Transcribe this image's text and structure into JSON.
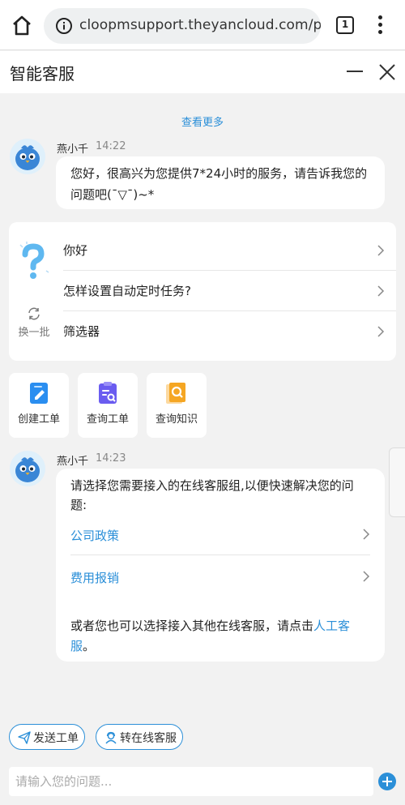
{
  "browser": {
    "url": "cloopmsupport.theyancloud.com/por",
    "tab_count": "1"
  },
  "chat": {
    "title": "智能客服",
    "load_more": "查看更多"
  },
  "messages": [
    {
      "sender": "燕小千",
      "time": "14:22",
      "text_line1": "您好，很高兴为您提供7*24小时的服务，请告诉我您的",
      "text_line2": "问题吧(¯▽¯)~*"
    },
    {
      "sender": "燕小千",
      "time": "14:23",
      "intro_line1": "请选择您需要接入的在线客服组,以便快速解决您的问",
      "intro_line2": "题:",
      "groups": [
        "公司政策",
        "费用报销"
      ],
      "outro_line1_prefix": "或者您也可以选择接入其他在线客服，请点击",
      "outro_link_part1": "人工客",
      "outro_link_part2": "服",
      "outro_suffix": "。"
    }
  ],
  "faq": {
    "refresh_label": "换一批",
    "items": [
      "你好",
      "怎样设置自动定时任务?",
      "筛选器"
    ]
  },
  "quick_actions": [
    {
      "label": "创建工单",
      "icon": "create-ticket-icon",
      "color": "#2a8ef0"
    },
    {
      "label": "查询工单",
      "icon": "query-ticket-icon",
      "color": "#6a5cf0"
    },
    {
      "label": "查询知识",
      "icon": "query-knowledge-icon",
      "color": "#f5a623"
    }
  ],
  "bottom": {
    "send_ticket": "发送工单",
    "transfer_online": "转在线客服",
    "input_placeholder": "请输入您的问题..."
  },
  "colors": {
    "accent": "#2b8fd8",
    "background": "#f2f2f2"
  }
}
